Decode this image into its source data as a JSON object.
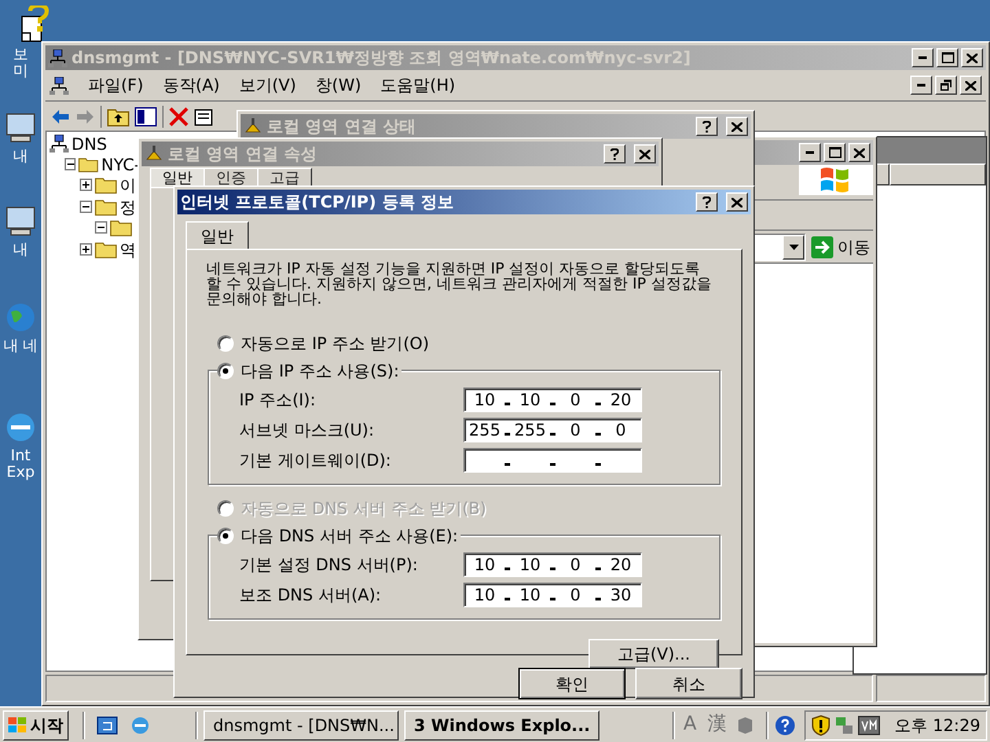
{
  "desktop": {
    "icons": [
      {
        "lines": [
          "보",
          "미"
        ]
      },
      {
        "lines": [
          "내"
        ]
      },
      {
        "lines": [
          "내"
        ]
      },
      {
        "lines": [
          "내 네"
        ]
      },
      {
        "lines": [
          "Int",
          "Exp"
        ]
      }
    ]
  },
  "main_window": {
    "title": "dnsmgmt - [DNS₩NYC-SVR1₩정방향 조회 영역₩nate.com₩nyc-svr2]",
    "menu": [
      "파일(F)",
      "동작(A)",
      "보기(V)",
      "창(W)",
      "도움말(H)"
    ],
    "tree": [
      {
        "label": "DNS",
        "children": [
          {
            "label": "NYC-",
            "expanded": true,
            "children": [
              {
                "label": "이",
                "expanded": false
              },
              {
                "label": "정",
                "expanded": true,
                "children": [
                  {
                    "expanded": true
                  }
                ]
              },
              {
                "label": "역",
                "expanded": false
              }
            ]
          }
        ]
      }
    ]
  },
  "status_dialog": {
    "title": "로컬 영역 연결 상태"
  },
  "properties_dialog": {
    "title": "로컬 영역 연결 속성",
    "tabs": [
      {
        "label": "일반",
        "selected": true
      },
      {
        "label": "인증",
        "selected": false
      },
      {
        "label": "고급",
        "selected": false
      }
    ]
  },
  "explorer": {
    "go_button": "이동"
  },
  "tcpip_dialog": {
    "title": "인터넷 프로토콜(TCP/IP) 등록 정보",
    "tabs": [
      {
        "label": "일반",
        "selected": true
      }
    ],
    "description": "네트워크가 IP 자동 설정 기능을 지원하면 IP 설정이 자동으로 할당되도록 할 수 있습니다. 지원하지 않으면, 네트워크 관리자에게 적절한 IP 설정값을 문의해야 합니다.",
    "ip": {
      "auto_option": {
        "label": "자동으로 IP 주소 받기(O)",
        "selected": false,
        "disabled": false
      },
      "manual_option": {
        "label": "다음 IP 주소 사용(S):",
        "selected": true,
        "disabled": false
      },
      "fields": [
        {
          "label": "IP 주소(I):",
          "octets": [
            "10",
            "10",
            "0",
            "20"
          ]
        },
        {
          "label": "서브넷 마스크(U):",
          "octets": [
            "255",
            "255",
            "0",
            "0"
          ]
        },
        {
          "label": "기본 게이트웨이(D):"
        }
      ]
    },
    "dns": {
      "auto_option": {
        "label": "자동으로 DNS 서버 주소 받기(B)",
        "selected": false,
        "disabled": true
      },
      "manual_option": {
        "label": "다음 DNS 서버 주소 사용(E):",
        "selected": true,
        "disabled": false
      },
      "fields": [
        {
          "label": "기본 설정 DNS 서버(P):",
          "octets": [
            "10",
            "10",
            "0",
            "20"
          ]
        },
        {
          "label": "보조 DNS 서버(A):",
          "octets": [
            "10",
            "10",
            "0",
            "30"
          ]
        }
      ]
    },
    "advanced_button": "고급(V)...",
    "ok_button": "확인",
    "cancel_button": "취소"
  },
  "taskbar": {
    "start": "시작",
    "tasks": [
      {
        "label": "dnsmgmt - [DNS₩N...",
        "kind": "window",
        "selected": false
      },
      {
        "label": "3 Windows Explo...",
        "kind": "group",
        "selected": false
      }
    ],
    "ime": [
      "A",
      "漢"
    ],
    "clock": "오후 12:29"
  }
}
